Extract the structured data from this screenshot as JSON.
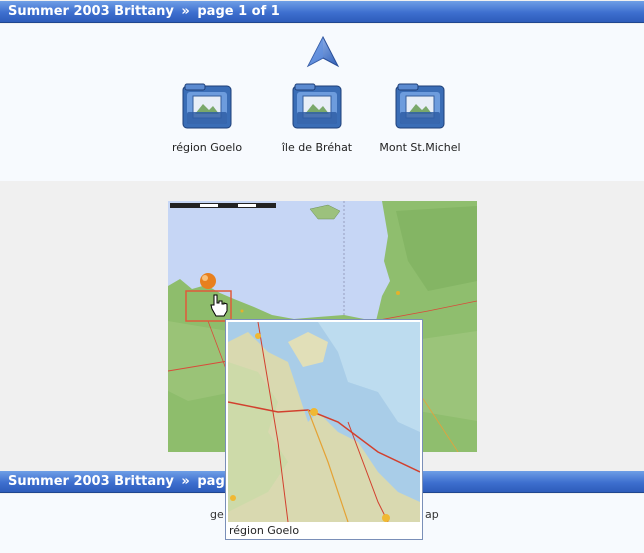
{
  "header": {
    "album": "Summer 2003 Brittany",
    "separator": "»",
    "page_text": "page 1 of 1"
  },
  "footer": {
    "album": "Summer 2003 Brittany",
    "separator": "»",
    "page_text": "page 1",
    "left_text": "ge",
    "right_text": "ap"
  },
  "folders": [
    {
      "label": "région Goelo",
      "icon": "folder-icon"
    },
    {
      "label": "île de Bréhat",
      "icon": "folder-icon"
    },
    {
      "label": "Mont St.Michel",
      "icon": "folder-icon"
    }
  ],
  "up_icon": "up-arrow-icon",
  "tooltip": {
    "caption": "région Goelo"
  },
  "colors": {
    "title_bar": "#3e6fcf",
    "sea": "#c7d7f4",
    "land": "#8fbf70",
    "highlight_box": "#e05a3a"
  }
}
